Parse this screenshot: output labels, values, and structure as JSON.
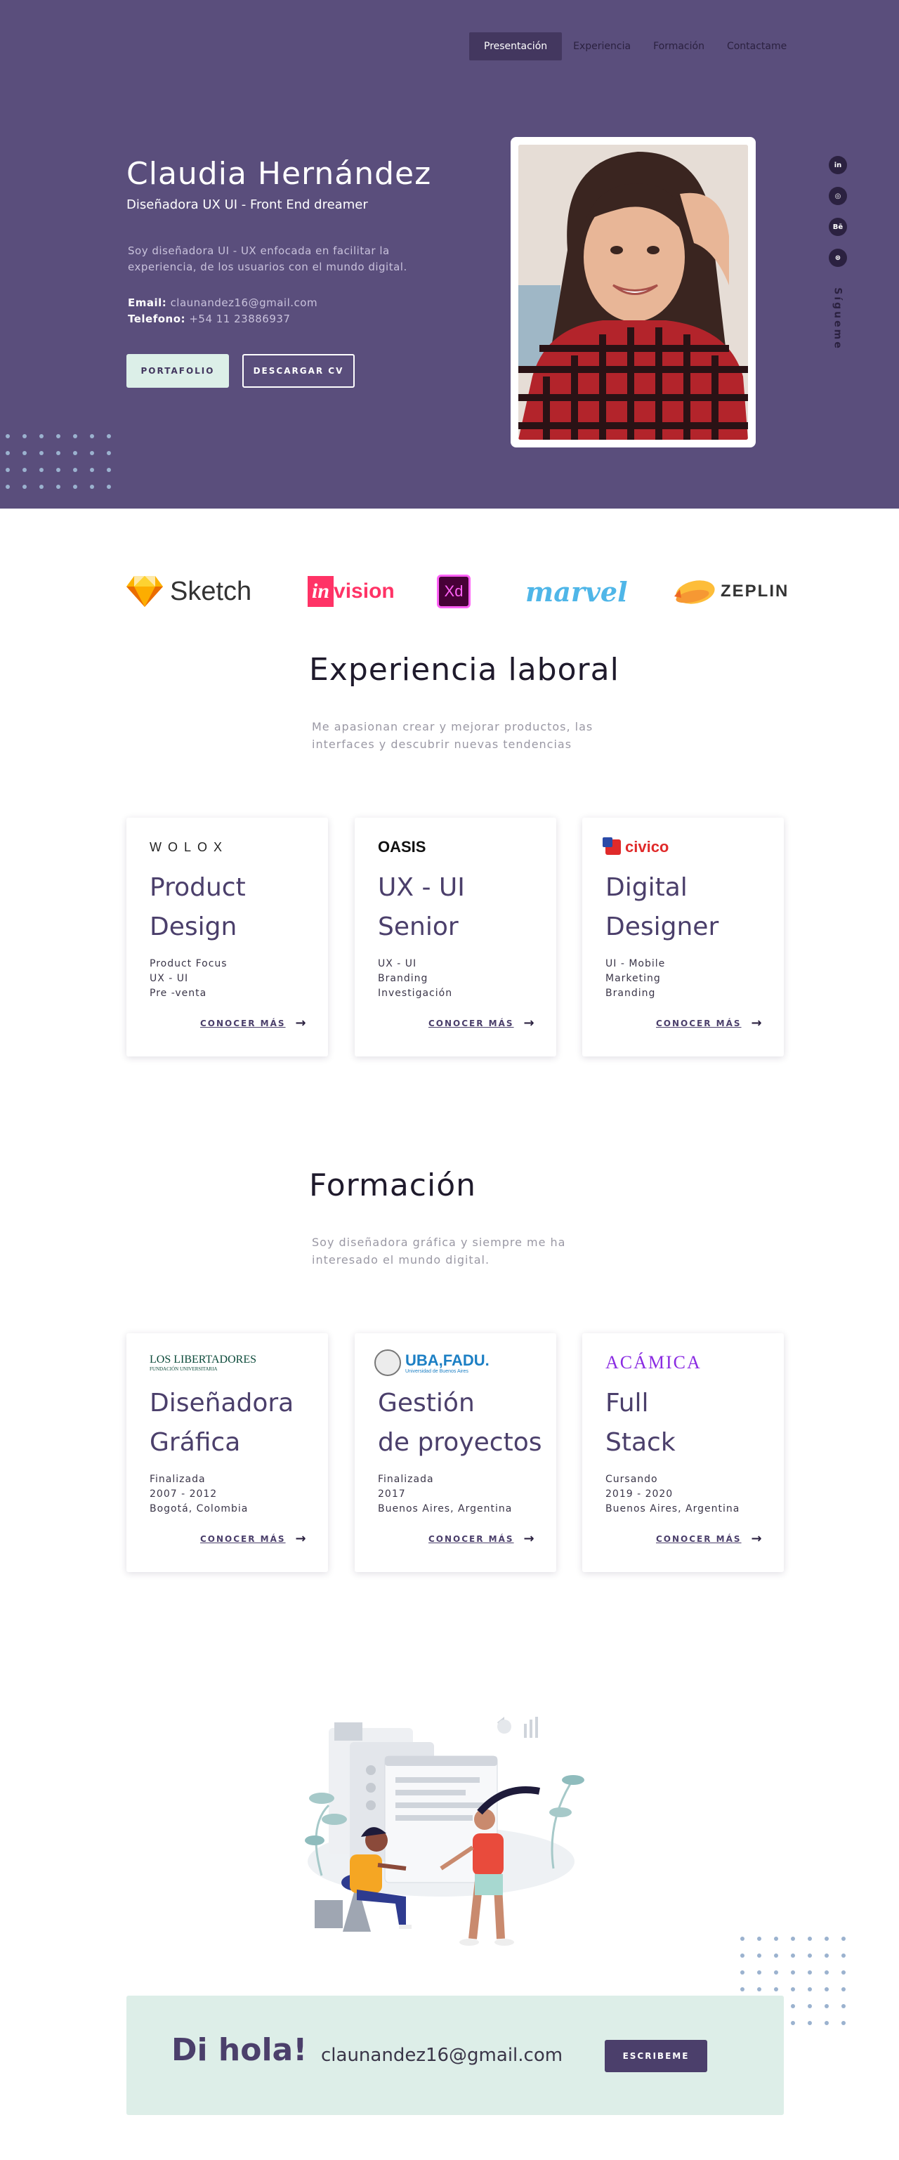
{
  "nav": {
    "items": [
      "Presentación",
      "Experiencia",
      "Formación",
      "Contactame"
    ]
  },
  "hero": {
    "name": "Claudia Hernández",
    "role": "Diseñadora UX UI - Front End dreamer",
    "description": "Soy diseñadora UI - UX enfocada en facilitar la experiencia, de los usuarios con el mundo digital.",
    "email_label": "Email:",
    "email": "claunandez16@gmail.com",
    "phone_label": "Telefono:",
    "phone": "+54 11 23886937",
    "portfolio_button": "PORTAFOLIO",
    "cv_button": "DESCARGAR CV",
    "follow_label": "Sígueme",
    "social_icons": [
      "linkedin-icon",
      "instagram-icon",
      "behance-icon",
      "dribbble-icon"
    ],
    "social_glyphs": [
      "in",
      "◎",
      "Bē",
      "⊛"
    ]
  },
  "tools": {
    "sketch": "Sketch",
    "invision_in": "in",
    "invision_rest": "vision",
    "xd": "Xd",
    "marvel": "marvel",
    "zeplin": "ZEPLIN"
  },
  "experience": {
    "title": "Experiencia laboral",
    "description": "Me apasionan crear y mejorar productos, las interfaces y descubrir nuevas tendencias",
    "cards": [
      {
        "logo": "WOLOX",
        "title_line1": "Product",
        "title_line2": "Design",
        "lines": [
          "Product Focus",
          "UX - UI",
          "Pre -venta"
        ],
        "link": "CONOCER MÁS"
      },
      {
        "logo": "OASIS",
        "title_line1": "UX - UI",
        "title_line2": "Senior",
        "lines": [
          "UX - UI",
          "Branding",
          "Investigación"
        ],
        "link": "CONOCER MÁS"
      },
      {
        "logo": "civico",
        "title_line1": "Digital",
        "title_line2": "Designer",
        "lines": [
          "UI - Mobile",
          "Marketing",
          "Branding"
        ],
        "link": "CONOCER MÁS"
      }
    ]
  },
  "education": {
    "title": "Formación",
    "description": "Soy diseñadora gráfica y siempre me ha interesado el mundo digital.",
    "cards": [
      {
        "logo": "LOS LIBERTADORES",
        "logo_sub": "FUNDACIÓN UNIVERSITARIA",
        "title_line1": "Diseñadora",
        "title_line2": "Gráfica",
        "lines": [
          "Finalizada",
          "2007 - 2012",
          "Bogotá, Colombia"
        ],
        "link": "CONOCER MÁS"
      },
      {
        "logo": "UBA,FADU.",
        "logo_sub": "Universidad de Buenos Aires",
        "title_line1": "Gestión",
        "title_line2": "de proyectos",
        "lines": [
          "Finalizada",
          "2017",
          "Buenos Aires, Argentina"
        ],
        "link": "CONOCER MÁS"
      },
      {
        "logo": "ACÁMICA",
        "logo_sub": "",
        "title_line1": "Full",
        "title_line2": "Stack",
        "lines": [
          "Cursando",
          "2019 - 2020",
          "Buenos Aires, Argentina"
        ],
        "link": "CONOCER MÁS"
      }
    ]
  },
  "contact": {
    "title": "Di hola!",
    "email": "claunandez16@gmail.com",
    "button": "ESCRIBEME"
  },
  "colors": {
    "hero_bg": "#5a4e7c",
    "accent": "#4b3f6b",
    "mint": "#ddeee8"
  }
}
